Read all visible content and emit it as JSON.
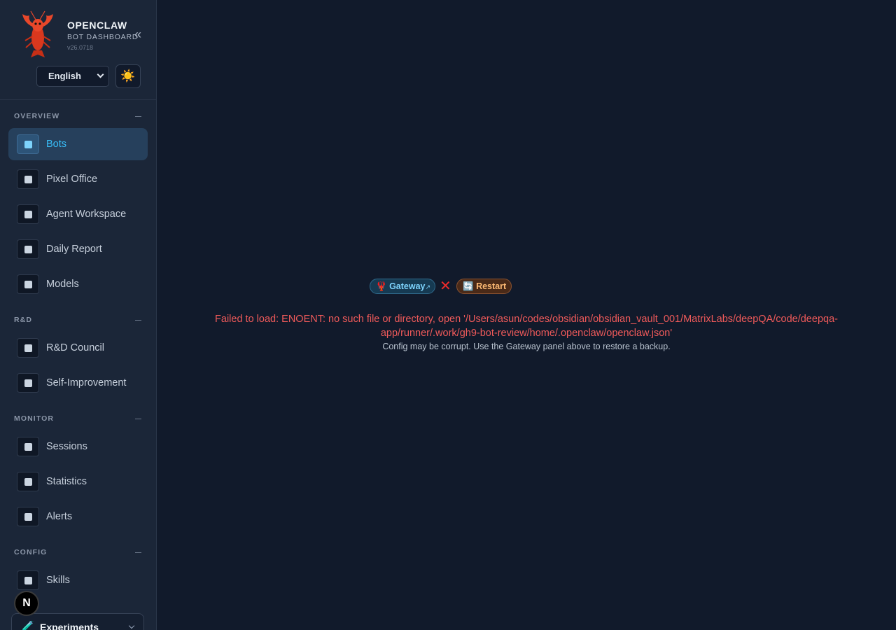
{
  "brand": {
    "title": "OPENCLAW",
    "subtitle": "BOT DASHBOARD",
    "version": "v26.0718",
    "collapse_glyph": "«",
    "logo_icon": "lobster-logo-icon"
  },
  "controls": {
    "language": "English",
    "theme_icon": "☀️"
  },
  "sections": {
    "overview": "OVERVIEW",
    "rnd": "R&D",
    "monitor": "MONITOR",
    "config": "CONFIG"
  },
  "nav": {
    "bots": "Bots",
    "pixel_office": "Pixel Office",
    "agent_workspace": "Agent Workspace",
    "daily_report": "Daily Report",
    "models": "Models",
    "rnd_council": "R&D Council",
    "self_improvement": "Self-Improvement",
    "sessions": "Sessions",
    "statistics": "Statistics",
    "alerts": "Alerts",
    "skills": "Skills"
  },
  "next_badge": "N",
  "experiments": {
    "icon": "🧪",
    "label": "Experiments"
  },
  "status": {
    "gateway_icon": "🦞",
    "gateway_label": "Gateway",
    "gateway_ext": "↗",
    "error_mark": "✕",
    "restart_icon": "🔄",
    "restart_label": "Restart"
  },
  "error": {
    "message": "Failed to load: ENOENT: no such file or directory, open '/Users/asun/codes/obsidian/obsidian_vault_001/MatrixLabs/deepQA/code/deepqa-app/runner/.work/gh9-bot-review/home/.openclaw/openclaw.json'",
    "hint": "Config may be corrupt. Use the Gateway panel above to restore a backup."
  },
  "colors": {
    "accent": "#38bdf8",
    "error": "#f05a5a",
    "restart": "#fdba74"
  }
}
